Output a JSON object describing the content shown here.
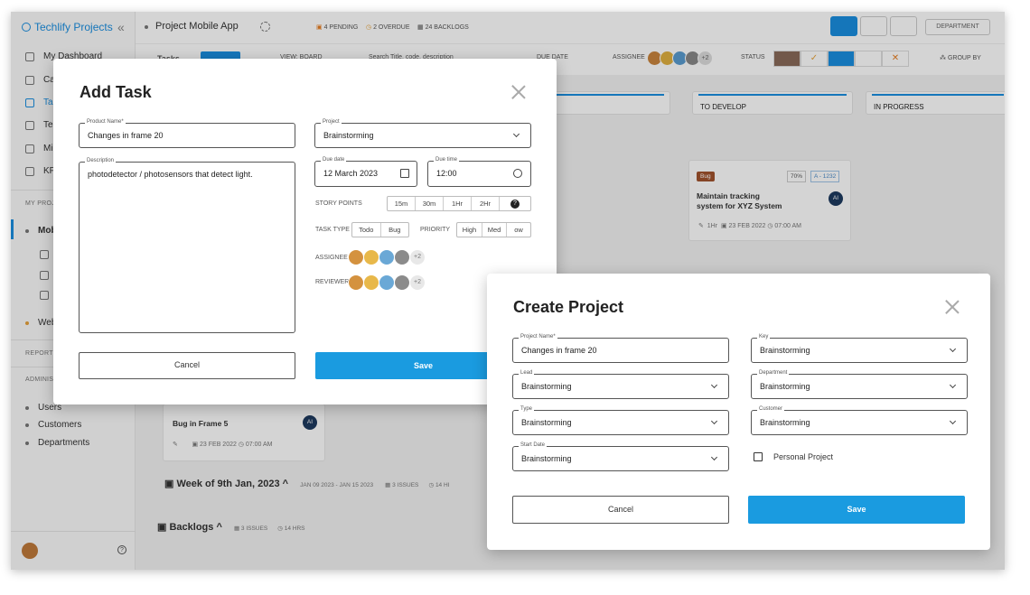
{
  "brand": {
    "name": "Techlify Projects"
  },
  "sidebar": {
    "items": [
      {
        "label": "My Dashboard"
      },
      {
        "label": "Ca"
      },
      {
        "label": "Ta"
      },
      {
        "label": "Te"
      },
      {
        "label": "Mi"
      },
      {
        "label": "KP"
      }
    ],
    "my_projects_label": "MY PROJ",
    "project_current": "Mob",
    "project_other": "Web",
    "reports_label": "REPORTS",
    "admin_label": "ADMINIS",
    "admin_items": [
      {
        "label": "Users"
      },
      {
        "label": "Customers"
      },
      {
        "label": "Departments"
      }
    ]
  },
  "topbar": {
    "project_title": "Project Mobile App",
    "pending": "4 PENDING",
    "overdue": "2 OVERDUE",
    "backlogs": "24 BACKLOGS",
    "department": "DEPARTMENT"
  },
  "toolbar": {
    "tasks_label": "Tasks",
    "view": "VIEW: BOARD",
    "search_placeholder": "Search Title, code, description",
    "date": "DUE DATE",
    "assignee_label": "ASSIGNEE",
    "assignee_more": "+2",
    "status_label": "STATUS",
    "group_by": "GROUP BY"
  },
  "board": {
    "columns": [
      {
        "title": "TO DEVELOP"
      },
      {
        "title": "IN PROGRESS"
      }
    ],
    "card1": {
      "tag": "Bug",
      "percent": "70%",
      "code": "A - 1232",
      "title_line1": "Maintain tracking",
      "title_line2": "system for XYZ System",
      "avatar": "AI",
      "hours": "1Hr",
      "date": "23 FEB 2022",
      "time": "07:00 AM"
    },
    "card2": {
      "title": "Bug in Frame 5",
      "avatar": "AI",
      "date": "23 FEB 2022",
      "time": "07:00 AM"
    },
    "week": {
      "title": "Week of 9th Jan, 2023",
      "range": "JAN 09 2023 - JAN 15 2023",
      "issues": "3 ISSUES",
      "hours": "14 HI"
    },
    "backlogs": {
      "title": "Backlogs",
      "issues": "3 ISSUES",
      "hours": "14 HRS"
    }
  },
  "add_task": {
    "title": "Add Task",
    "product_name": {
      "label": "Product Name*",
      "value": "Changes in frame 20"
    },
    "project": {
      "label": "Project",
      "value": "Brainstorming"
    },
    "description": {
      "label": "Description",
      "value": "photodetector / photosensors that detect light."
    },
    "due_date": {
      "label": "Due date",
      "value": "12 March 2023"
    },
    "due_time": {
      "label": "Due time",
      "value": "12:00"
    },
    "story_points": {
      "label": "STORY POINTS",
      "options": [
        "15m",
        "30m",
        "1Hr",
        "2Hr"
      ]
    },
    "task_type": {
      "label": "TASK TYPE",
      "options": [
        "Todo",
        "Bug"
      ]
    },
    "priority": {
      "label": "PRIORITY",
      "options": [
        "High",
        "Med",
        "ow"
      ]
    },
    "assignee": {
      "label": "ASSIGNEE",
      "more": "+2"
    },
    "reviewer": {
      "label": "REVIEWER",
      "more": "+2"
    },
    "cancel": "Cancel",
    "save": "Save"
  },
  "create_project": {
    "title": "Create Project",
    "project_name": {
      "label": "Project Name*",
      "value": "Changes in frame 20"
    },
    "key": {
      "label": "Key",
      "value": "Brainstorming"
    },
    "lead": {
      "label": "Lead",
      "value": "Brainstorming"
    },
    "department": {
      "label": "Department",
      "value": "Brainstorming"
    },
    "type": {
      "label": "Type",
      "value": "Brainstorming"
    },
    "customer": {
      "label": "Customer",
      "value": "Brainstorming"
    },
    "start_date": {
      "label": "Start Date",
      "value": "Brainstorming"
    },
    "personal_project": "Personal Project",
    "cancel": "Cancel",
    "save": "Save"
  },
  "colors": {
    "accent": "#1a9be0",
    "bug_tag": "#a0522d"
  }
}
